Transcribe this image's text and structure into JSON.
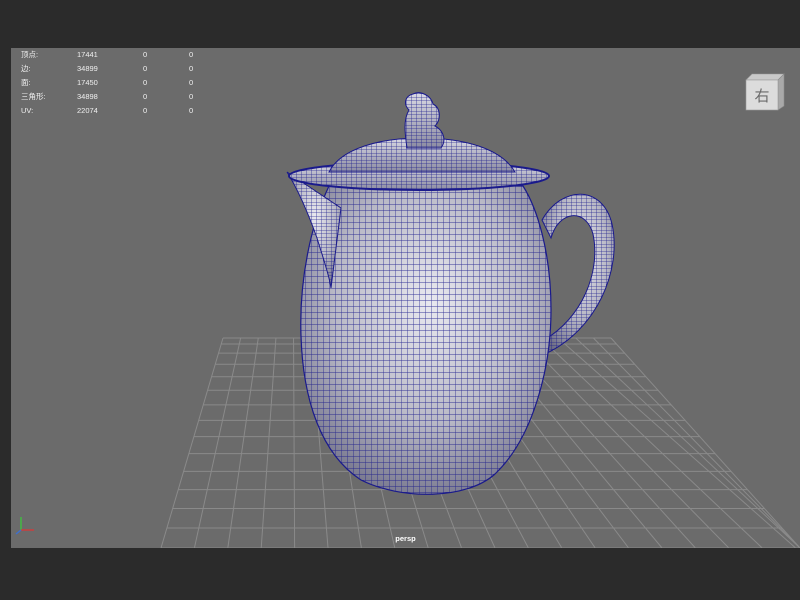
{
  "hud": {
    "rows": [
      {
        "label": "顶点:",
        "total": "17441",
        "a": "0",
        "b": "0"
      },
      {
        "label": "边:",
        "total": "34899",
        "a": "0",
        "b": "0"
      },
      {
        "label": "面:",
        "total": "17450",
        "a": "0",
        "b": "0"
      },
      {
        "label": "三角形:",
        "total": "34898",
        "a": "0",
        "b": "0"
      },
      {
        "label": "UV:",
        "total": "22074",
        "a": "0",
        "b": "0"
      }
    ]
  },
  "viewcube": {
    "face_label": "右"
  },
  "camera_label": "persp",
  "colors": {
    "viewport_bg": "#6b6b6b",
    "frame_bg": "#2b2b2b",
    "wire": "#1a1a8c",
    "grid": "#8a8a8a",
    "hud_text": "#f0f0f0"
  },
  "icons": {
    "viewcube": "view-cube-icon",
    "axis": "axis-gizmo-icon"
  },
  "scene_object": "teapot-wireframe-mesh"
}
